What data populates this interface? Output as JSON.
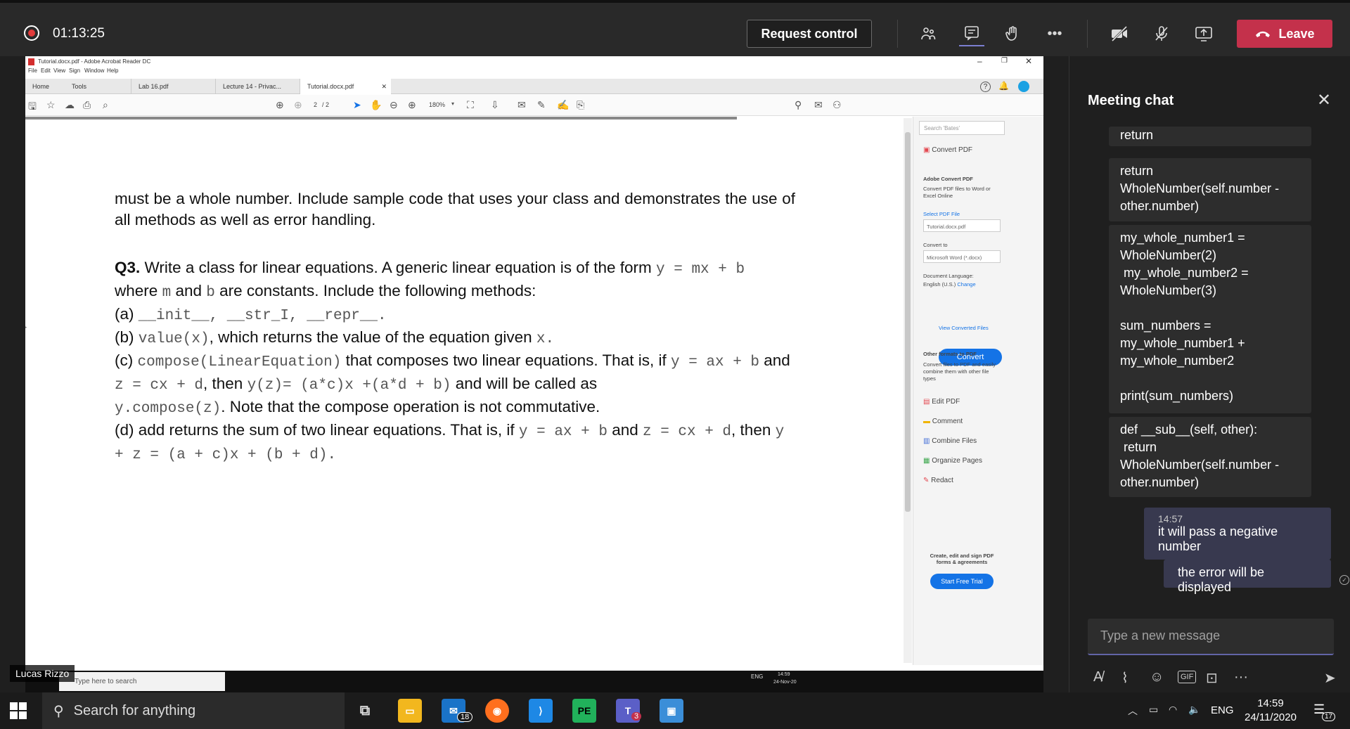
{
  "teams": {
    "recording_time": "01:13:25",
    "request_control": "Request control",
    "leave": "Leave",
    "more": "•••"
  },
  "acrobat": {
    "window_title": "Tutorial.docx.pdf - Adobe Acrobat Reader DC",
    "menu": [
      "File",
      "Edit",
      "View",
      "Sign",
      "Window",
      "Help"
    ],
    "tabs": [
      "Home",
      "Tools",
      "Lab 16.pdf",
      "Lecture 14 - Privac...",
      "Tutorial.docx.pdf"
    ],
    "page_current": "2",
    "page_total": "/ 2",
    "zoom": "180%",
    "pane": {
      "search": "Search 'Bates'",
      "convert_pdf": "Convert PDF",
      "adobe_convert_pdf": "Adobe Convert PDF",
      "convert_desc": "Convert PDF files to Word or Excel Online",
      "select_pdf_file": "Select PDF File",
      "selected_file": "Tutorial.docx.pdf",
      "convert_to": "Convert to",
      "convert_format": "Microsoft Word (*.docx)",
      "document_language": "Document Language:",
      "language_value": "English (U.S.)",
      "change": "Change",
      "convert_button": "Convert",
      "view_converted": "View Converted Files",
      "other_formats": "Other formats to PDF",
      "other_desc": "Convert files to PDF and easily combine them with other file types",
      "tools": [
        "Edit PDF",
        "Comment",
        "Combine Files",
        "Organize Pages",
        "Redact"
      ],
      "promo": "Create, edit and sign PDF forms & agreements",
      "free_trial": "Start Free Trial"
    }
  },
  "document": {
    "para1": "must be a whole number. Include sample code that uses your class and demonstrates the use of all methods as well as error handling.",
    "q3_label": "Q3.",
    "q3_intro": "Write a class for linear equations. A generic linear equation is of the form",
    "form": "y = mx + b",
    "where": "where",
    "m": "m",
    "and": "and",
    "b": "b",
    "constants": "are constants. Include the following methods:",
    "a_label": "(a)",
    "a_methods": "__init__, __str_I, __repr__.",
    "b_label": "(b)",
    "b_method": "value(x)",
    "b_text": ", which returns the value of the equation given",
    "b_x": "x.",
    "c_label": "(c)",
    "c_method": "compose(LinearEquation)",
    "c_text1": "that composes two linear equations. That is, if",
    "c_eq1": "y = ax + b",
    "c_and": "and",
    "c_eq2": "z = cx + d",
    "c_then": ", then",
    "c_eq3": "y(z)= (a*c)x +(a*d + b)",
    "c_text2": "and will be called as",
    "c_call": "y.compose(z)",
    "c_text3": ". Note that the compose operation is not commutative.",
    "d_label": "(d)",
    "d_text1": "add returns the sum of two linear equations. That is, if",
    "d_eq1": "y = ax + b",
    "d_and": "and",
    "d_eq2": "z = cx + d",
    "d_then": ", then",
    "d_eq3": "y + z = (a + c)x + (b + d)."
  },
  "inner_taskbar": {
    "search": "Type here to search",
    "time": "14:59",
    "date": "24-Nov-20",
    "lang": "ENG"
  },
  "presenter": "Lucas Rizzo",
  "chat": {
    "title": "Meeting chat",
    "messages": [
      "return",
      "return\nWholeNumber(self.number -\nother.number)",
      "my_whole_number1 =\nWholeNumber(2)\n my_whole_number2 =\nWholeNumber(3)\n\nsum_numbers =\nmy_whole_number1 +\nmy_whole_number2\n\nprint(sum_numbers)",
      "def __sub__(self, other):\n return\nWholeNumber(self.number -\nother.number)"
    ],
    "my_time": "14:57",
    "my_messages": [
      "it will pass a negative number",
      "the error will be displayed"
    ],
    "input_placeholder": "Type a new message"
  },
  "os": {
    "search": "Search for anything",
    "mail_badge": "18",
    "teams_badge": "3",
    "lang": "ENG",
    "time": "14:59",
    "date": "24/11/2020",
    "notif_count": "17"
  },
  "colors": {
    "leave": "#c4314b",
    "teams_accent": "#6264a7",
    "acrobat_blue": "#1473e6"
  }
}
